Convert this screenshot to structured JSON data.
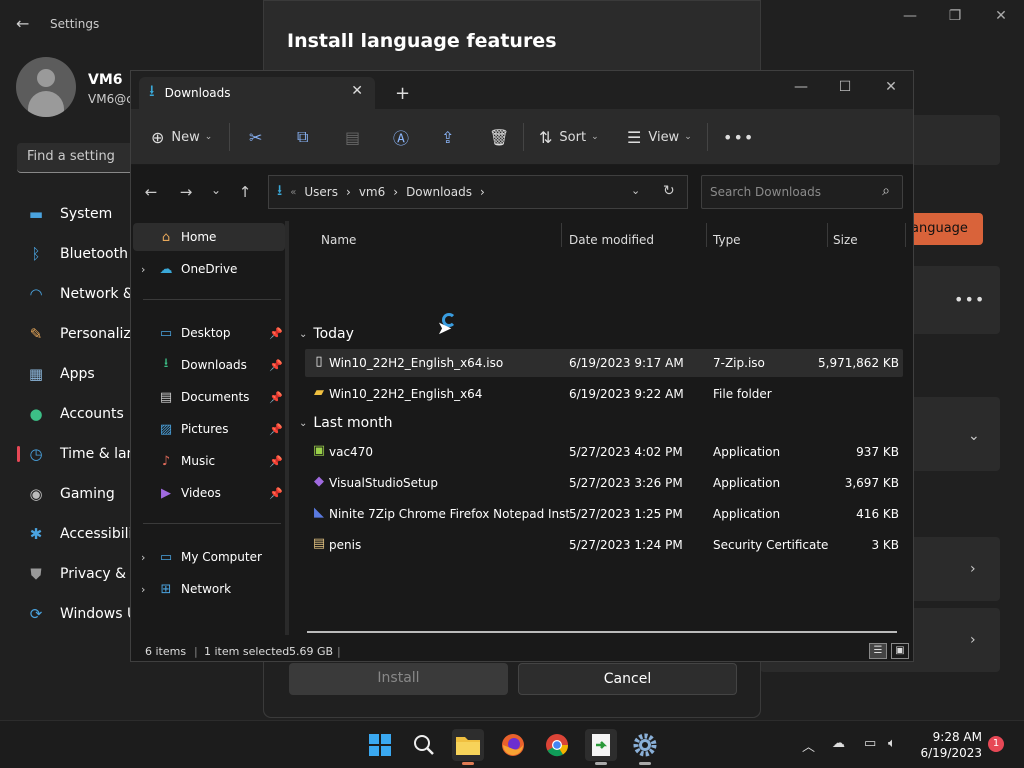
{
  "settings": {
    "title": "Settings",
    "user_name": "VM6",
    "user_email": "VM6@c",
    "search_placeholder": "Find a setting",
    "nav": [
      {
        "label": "System",
        "icon": "monitor-icon"
      },
      {
        "label": "Bluetooth &",
        "icon": "bluetooth-icon"
      },
      {
        "label": "Network &",
        "icon": "wifi-icon"
      },
      {
        "label": "Personaliza",
        "icon": "brush-icon"
      },
      {
        "label": "Apps",
        "icon": "apps-icon"
      },
      {
        "label": "Accounts",
        "icon": "person-icon"
      },
      {
        "label": "Time & lang",
        "icon": "clock-globe-icon"
      },
      {
        "label": "Gaming",
        "icon": "gamepad-icon"
      },
      {
        "label": "Accessibility",
        "icon": "accessibility-icon"
      },
      {
        "label": "Privacy & se",
        "icon": "shield-icon"
      },
      {
        "label": "Windows U",
        "icon": "update-icon"
      }
    ],
    "language_button": "anguage"
  },
  "dialog": {
    "title": "Install language features",
    "install_label": "Install",
    "cancel_label": "Cancel"
  },
  "file_dialog": {
    "tab_label": "Downloads",
    "toolbar": {
      "new_label": "New",
      "sort_label": "Sort",
      "view_label": "View"
    },
    "breadcrumb": [
      "Users",
      "vm6",
      "Downloads"
    ],
    "search_placeholder": "Search Downloads",
    "nav_pane": {
      "home": "Home",
      "onedrive": "OneDrive",
      "quick": [
        {
          "label": "Desktop",
          "icon": "desktop-icon"
        },
        {
          "label": "Downloads",
          "icon": "download-icon"
        },
        {
          "label": "Documents",
          "icon": "document-icon"
        },
        {
          "label": "Pictures",
          "icon": "pictures-icon"
        },
        {
          "label": "Music",
          "icon": "music-icon"
        },
        {
          "label": "Videos",
          "icon": "video-icon"
        }
      ],
      "my_computer": "My Computer",
      "network": "Network"
    },
    "columns": {
      "name": "Name",
      "date": "Date modified",
      "type": "Type",
      "size": "Size"
    },
    "groups": [
      {
        "label": "Today",
        "files": [
          {
            "name": "Win10_22H2_English_x64.iso",
            "date": "6/19/2023 9:17 AM",
            "type": "7-Zip.iso",
            "size": "5,971,862 KB",
            "icon": "file-icon",
            "selected": true
          },
          {
            "name": "Win10_22H2_English_x64",
            "date": "6/19/2023 9:22 AM",
            "type": "File folder",
            "size": "",
            "icon": "folder-icon",
            "selected": false
          }
        ]
      },
      {
        "label": "Last month",
        "files": [
          {
            "name": "vac470",
            "date": "5/27/2023 4:02 PM",
            "type": "Application",
            "size": "937 KB",
            "icon": "app-icon",
            "selected": false
          },
          {
            "name": "VisualStudioSetup",
            "date": "5/27/2023 3:26 PM",
            "type": "Application",
            "size": "3,697 KB",
            "icon": "visual-studio-icon",
            "selected": false
          },
          {
            "name": "Ninite 7Zip Chrome Firefox Notepad Inst...",
            "date": "5/27/2023 1:25 PM",
            "type": "Application",
            "size": "416 KB",
            "icon": "ninite-icon",
            "selected": false
          },
          {
            "name": "penis",
            "date": "5/27/2023 1:24 PM",
            "type": "Security Certificate",
            "size": "3 KB",
            "icon": "certificate-icon",
            "selected": false
          }
        ]
      }
    ],
    "status": {
      "items": "6 items",
      "selected": "1 item selected",
      "size": "5.69 GB"
    }
  },
  "taskbar": {
    "time": "9:28 AM",
    "date": "6/19/2023",
    "notifications": "1"
  }
}
